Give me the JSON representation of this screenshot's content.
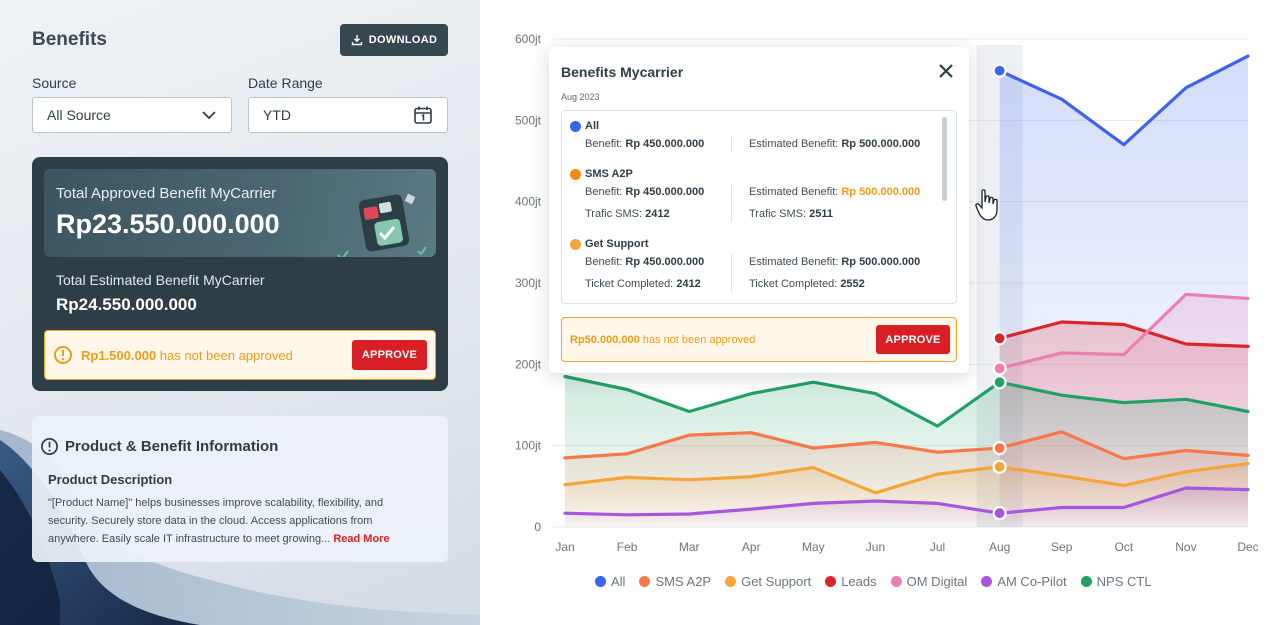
{
  "left": {
    "title": "Benefits",
    "download_label": "DOWNLOAD",
    "source_label": "Source",
    "source_value": "All Source",
    "date_label": "Date Range",
    "date_value": "YTD",
    "approved_title": "Total Approved Benefit MyCarrier",
    "approved_value": "Rp23.550.000.000",
    "estimated_title": "Total Estimated Benefit MyCarrier",
    "estimated_value": "Rp24.550.000.000",
    "warn_amount": "Rp1.500.000",
    "warn_text": "has not been approved",
    "approve_label": "APPROVE",
    "info_title": "Product & Benefit Information",
    "desc_title": "Product Description",
    "desc_text": "\"[Product Name]\" helps businesses improve scalability, flexibility, and security. Securely store data in the cloud. Access applications from anywhere. Easily scale IT infrastructure to meet growing...",
    "read_more": "Read More"
  },
  "popup": {
    "title": "Benefits Mycarrier",
    "subtitle": "Aug 2023",
    "groups": [
      {
        "name": "All",
        "color": "#3b63ee",
        "benefit_label": "Benefit:",
        "benefit": "Rp 450.000.000",
        "est_label": "Estimated Benefit:",
        "est": "Rp 500.000.000"
      },
      {
        "name": "SMS A2P",
        "color": "#f08c13",
        "benefit_label": "Benefit:",
        "benefit": "Rp 450.000.000",
        "est_label": "Estimated Benefit:",
        "est": "Rp 500.000.000",
        "extra_l_label": "Trafic SMS:",
        "extra_l": "2412",
        "extra_r_label": "Trafic SMS:",
        "extra_r": "2511"
      },
      {
        "name": "Get Support",
        "color": "#f6a43a",
        "benefit_label": "Benefit:",
        "benefit": "Rp 450.000.000",
        "est_label": "Estimated Benefit:",
        "est": "Rp 500.000.000",
        "extra_l_label": "Ticket Completed:",
        "extra_l": "2412",
        "extra_r_label": "Ticket Completed:",
        "extra_r": "2552"
      }
    ],
    "warn_amount": "Rp50.000.000",
    "warn_text": "has not been approved",
    "approve_label": "APPROVE"
  },
  "chart_data": {
    "type": "area",
    "categories": [
      "Jan",
      "Feb",
      "Mar",
      "Apr",
      "May",
      "Jun",
      "Jul",
      "Aug",
      "Sep",
      "Oct",
      "Nov",
      "Dec"
    ],
    "y_tick_labels": [
      "0",
      "100jt",
      "200jt",
      "300jt",
      "400jt",
      "500jt",
      "600jt"
    ],
    "ylim": [
      0,
      600
    ],
    "grid": true,
    "legend_position": "bottom",
    "highlighted_category": "Aug",
    "series": [
      {
        "name": "All",
        "color": "#3b63ee",
        "values": [
          null,
          null,
          null,
          null,
          null,
          null,
          null,
          561,
          526,
          470,
          540,
          579
        ]
      },
      {
        "name": "SMS A2P",
        "color": "#f5774a",
        "values": [
          85,
          90,
          113,
          116,
          97,
          104,
          92,
          97,
          117,
          84,
          94,
          88
        ]
      },
      {
        "name": "Get Support",
        "color": "#f6a43a",
        "values": [
          52,
          61,
          58,
          62,
          73,
          42,
          65,
          74,
          63,
          51,
          68,
          78
        ]
      },
      {
        "name": "Leads",
        "color": "#d9262a",
        "values": [
          null,
          null,
          null,
          null,
          null,
          null,
          null,
          232,
          252,
          249,
          225,
          222
        ]
      },
      {
        "name": "OM Digital",
        "color": "#ea7fb1",
        "values": [
          null,
          null,
          null,
          null,
          null,
          null,
          null,
          195,
          214,
          212,
          286,
          281
        ]
      },
      {
        "name": "AM Co-Pilot",
        "color": "#a657dd",
        "values": [
          17,
          15,
          16,
          22,
          29,
          32,
          29,
          17,
          24,
          24,
          48,
          46
        ]
      },
      {
        "name": "NPS CTL",
        "color": "#22a065",
        "values": [
          185,
          169,
          142,
          164,
          178,
          164,
          124,
          178,
          162,
          153,
          157,
          142
        ]
      }
    ]
  }
}
